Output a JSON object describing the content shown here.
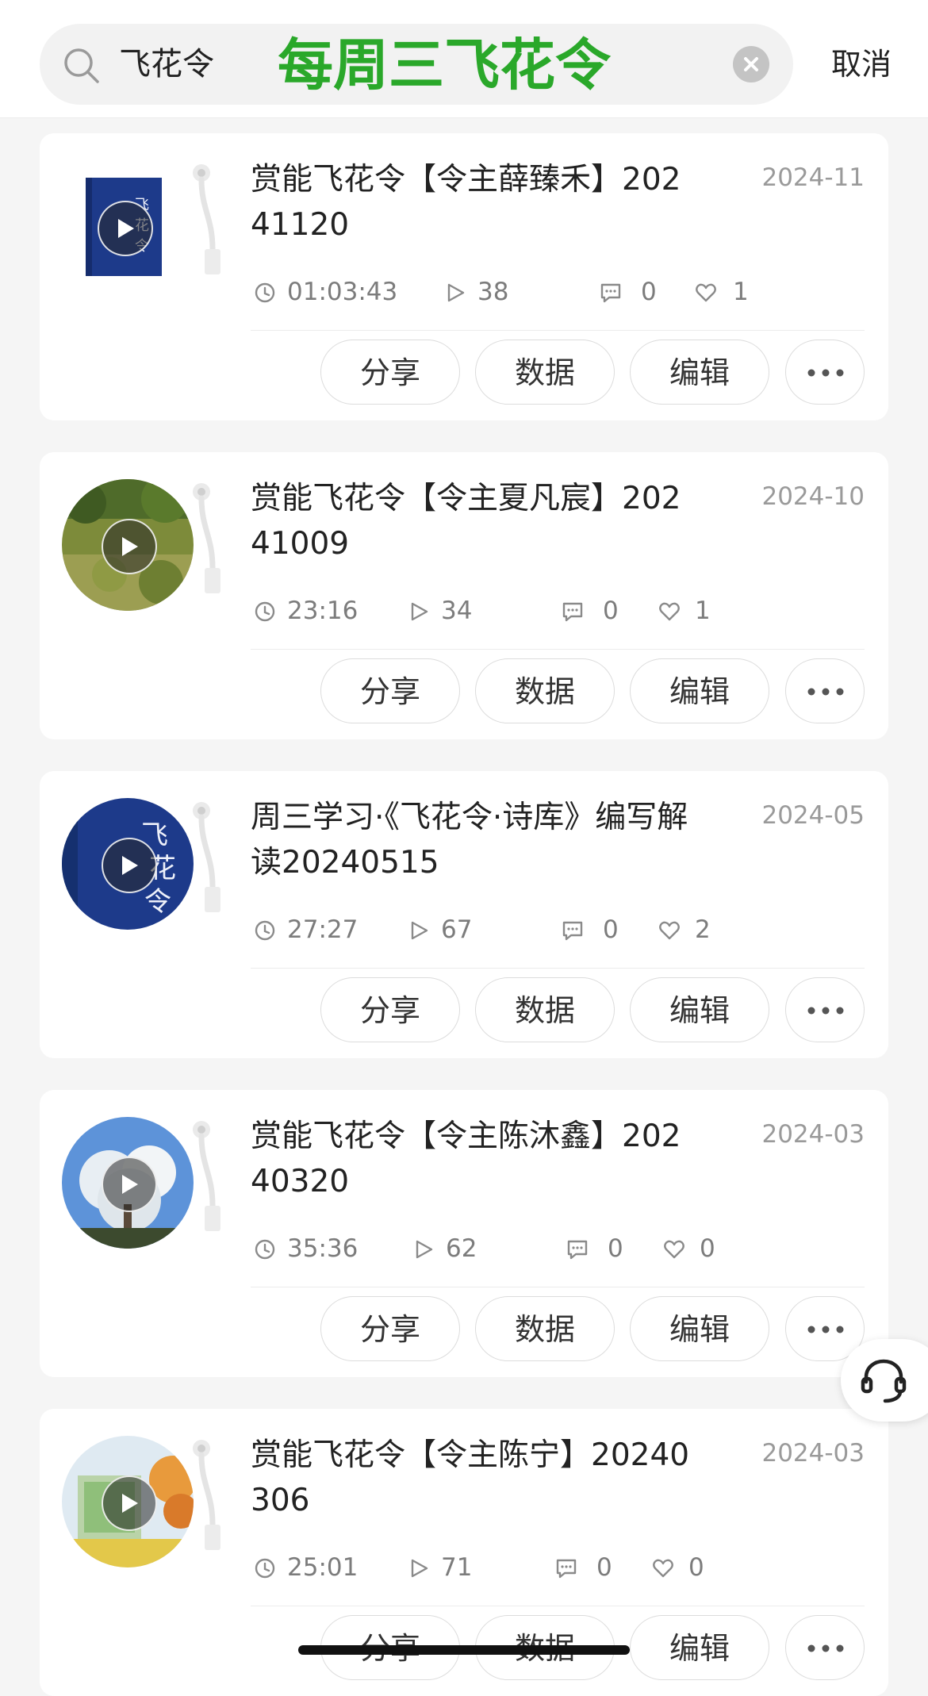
{
  "search": {
    "query": "飞花令",
    "overlay_caption": "每周三飞花令",
    "cancel_label": "取消"
  },
  "actions": {
    "share": "分享",
    "data": "数据",
    "edit": "编辑"
  },
  "items": [
    {
      "title": "赏能飞花令【令主薛臻禾】20241120",
      "date": "2024-11",
      "duration": "01:03:43",
      "plays": "38",
      "comments": "0",
      "likes": "1",
      "cover": "book-cover-blue"
    },
    {
      "title": "赏能飞花令【令主夏凡宸】20241009",
      "date": "2024-10",
      "duration": "23:16",
      "plays": "34",
      "comments": "0",
      "likes": "1",
      "cover": "green-field-photo"
    },
    {
      "title": "周三学习·《飞花令·诗库》编写解读20240515",
      "date": "2024-05",
      "duration": "27:27",
      "plays": "67",
      "comments": "0",
      "likes": "2",
      "cover": "book-cover-blue-calligraphy"
    },
    {
      "title": "赏能飞花令【令主陈沐鑫】20240320",
      "date": "2024-03",
      "duration": "35:36",
      "plays": "62",
      "comments": "0",
      "likes": "0",
      "cover": "blossom-tree-photo"
    },
    {
      "title": "赏能飞花令【令主陈宁】20240306",
      "date": "2024-03",
      "duration": "25:01",
      "plays": "71",
      "comments": "0",
      "likes": "0",
      "cover": "autumn-scene-photo"
    }
  ],
  "colors": {
    "overlay_green": "#2aa82a",
    "book_blue": "#1d3a8a",
    "muted_text": "#9a9a9a"
  }
}
